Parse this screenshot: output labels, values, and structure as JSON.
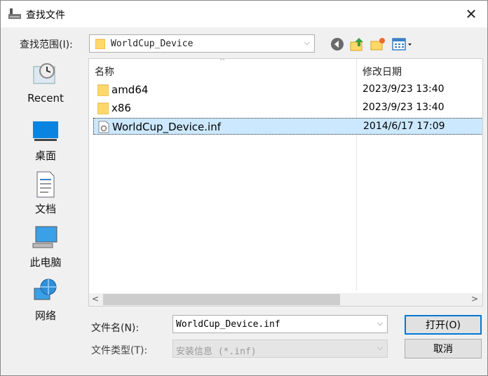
{
  "window": {
    "title": "查找文件"
  },
  "toolbar": {
    "lookin_label": "查找范围(I):",
    "lookin_value": "WorldCup_Device"
  },
  "places": [
    {
      "label": "Recent"
    },
    {
      "label": "桌面"
    },
    {
      "label": "文档"
    },
    {
      "label": "此电脑"
    },
    {
      "label": "网络"
    }
  ],
  "filelist": {
    "columns": {
      "name": "名称",
      "date": "修改日期"
    },
    "rows": [
      {
        "name": "amd64",
        "date": "2023/9/23 13:40",
        "type": "folder"
      },
      {
        "name": "x86",
        "date": "2023/9/23 13:40",
        "type": "folder"
      },
      {
        "name": "WorldCup_Device.inf",
        "date": "2014/6/17 17:09",
        "type": "file",
        "selected": true
      }
    ]
  },
  "form": {
    "filename_label": "文件名(N):",
    "filename_value": "WorldCup_Device.inf",
    "filetype_label": "文件类型(T):",
    "filetype_value": "安装信息 (*.inf)"
  },
  "buttons": {
    "open": "打开(O)",
    "cancel": "取消"
  },
  "colors": {
    "selection": "#cce8ff",
    "accent": "#0078d7",
    "folder": "#ffd86a"
  }
}
